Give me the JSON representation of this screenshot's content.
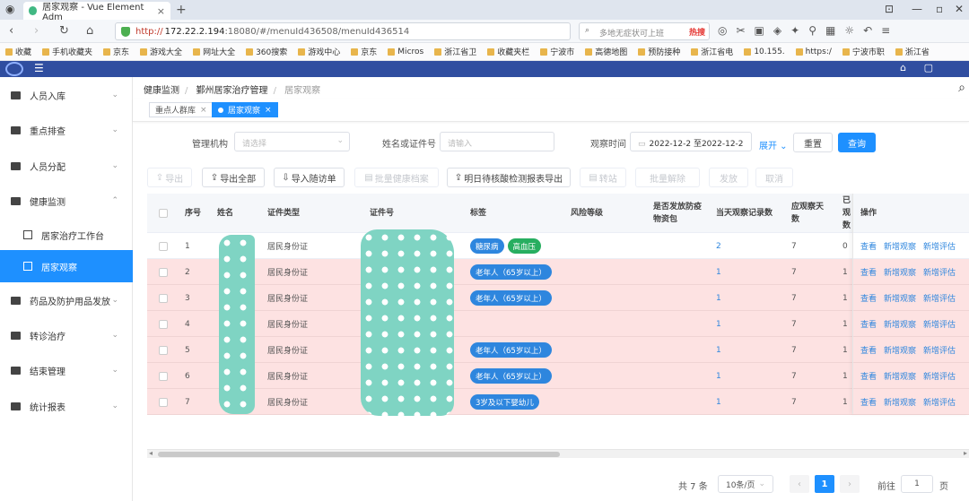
{
  "browser": {
    "tab_title": "居家观察 - Vue Element Adm",
    "url_scheme": "http://",
    "url_host": "172.22.2.194",
    "url_path": ":18080/#/menuId436508/menuId436514",
    "search_placeholder": "多地无症状可上班",
    "search_hot": "热搜",
    "bookmarks": [
      "收藏",
      "手机收藏夹",
      "京东",
      "游戏大全",
      "网址大全",
      "360搜索",
      "游戏中心",
      "京东",
      "Micros",
      "浙江省卫",
      "收藏夹栏",
      "宁波市",
      "高德地图",
      "预防接种",
      "浙江省电",
      "10.155.",
      "https:/",
      "宁波市职",
      "浙江省"
    ]
  },
  "sidebar": {
    "items": [
      {
        "label": "人员入库"
      },
      {
        "label": "重点排查"
      },
      {
        "label": "人员分配"
      },
      {
        "label": "健康监测"
      },
      {
        "label": "居家治疗工作台"
      },
      {
        "label": "居家观察"
      },
      {
        "label": "药品及防护用品发放"
      },
      {
        "label": "转诊治疗"
      },
      {
        "label": "结束管理"
      },
      {
        "label": "统计报表"
      }
    ]
  },
  "breadcrumb": [
    "健康监测",
    "鄞州居家治疗管理",
    "居家观察"
  ],
  "tags": [
    "重点人群库",
    "居家观察"
  ],
  "filters": {
    "org_label": "管理机构",
    "org_placeholder": "请选择",
    "name_label": "姓名或证件号",
    "name_placeholder": "请输入",
    "time_label": "观察时间",
    "date_range": "2022-12-2 至2022-12-2",
    "expand": "展开",
    "reset": "重置",
    "query": "查询"
  },
  "toolbar": {
    "export": "导出",
    "export_all": "导出全部",
    "import_visit": "导入随访单",
    "batch_health": "批量健康档案",
    "tomorrow_export": "明日待核酸检测报表导出",
    "transfer": "转站",
    "release": "批量解除",
    "dispense": "发放",
    "cancel": "取消"
  },
  "table": {
    "headers": [
      "序号",
      "姓名",
      "证件类型",
      "证件号",
      "标签",
      "风险等级",
      "是否发放防疫物资包",
      "当天观察记录数",
      "应观察天数",
      "已观数",
      "操作"
    ],
    "rows": [
      {
        "no": "1",
        "id_type": "居民身份证",
        "tags": [
          "糖尿病",
          "高血压"
        ],
        "records": "2",
        "days": "7",
        "observed": "0",
        "style": "first"
      },
      {
        "no": "2",
        "id_type": "居民身份证",
        "tags": [
          "老年人（65岁以上）"
        ],
        "records": "1",
        "days": "7",
        "observed": "1",
        "style": "pink"
      },
      {
        "no": "3",
        "id_type": "居民身份证",
        "tags": [
          "老年人（65岁以上）"
        ],
        "records": "1",
        "days": "7",
        "observed": "1",
        "style": "pink"
      },
      {
        "no": "4",
        "id_type": "居民身份证",
        "tags": [],
        "records": "1",
        "days": "7",
        "observed": "1",
        "style": "pink"
      },
      {
        "no": "5",
        "id_type": "居民身份证",
        "tags": [
          "老年人（65岁以上）"
        ],
        "records": "1",
        "days": "7",
        "observed": "1",
        "style": "pink"
      },
      {
        "no": "6",
        "id_type": "居民身份证",
        "tags": [
          "老年人（65岁以上）"
        ],
        "records": "1",
        "days": "7",
        "observed": "1",
        "style": "pink"
      },
      {
        "no": "7",
        "id_type": "居民身份证",
        "tags": [
          "3岁及以下婴幼儿"
        ],
        "records": "1",
        "days": "7",
        "observed": "1",
        "style": "pink"
      }
    ],
    "actions": [
      "查看",
      "新增观察",
      "新增评估"
    ]
  },
  "pagination": {
    "total": "共 7 条",
    "page_size": "10条/页",
    "current_page": "1",
    "goto_label": "前往",
    "goto_value": "1",
    "page_suffix": "页"
  },
  "colors": {
    "accent": "#1e90ff",
    "header_bar": "#304ea0",
    "row_highlight": "#fde2e2"
  }
}
